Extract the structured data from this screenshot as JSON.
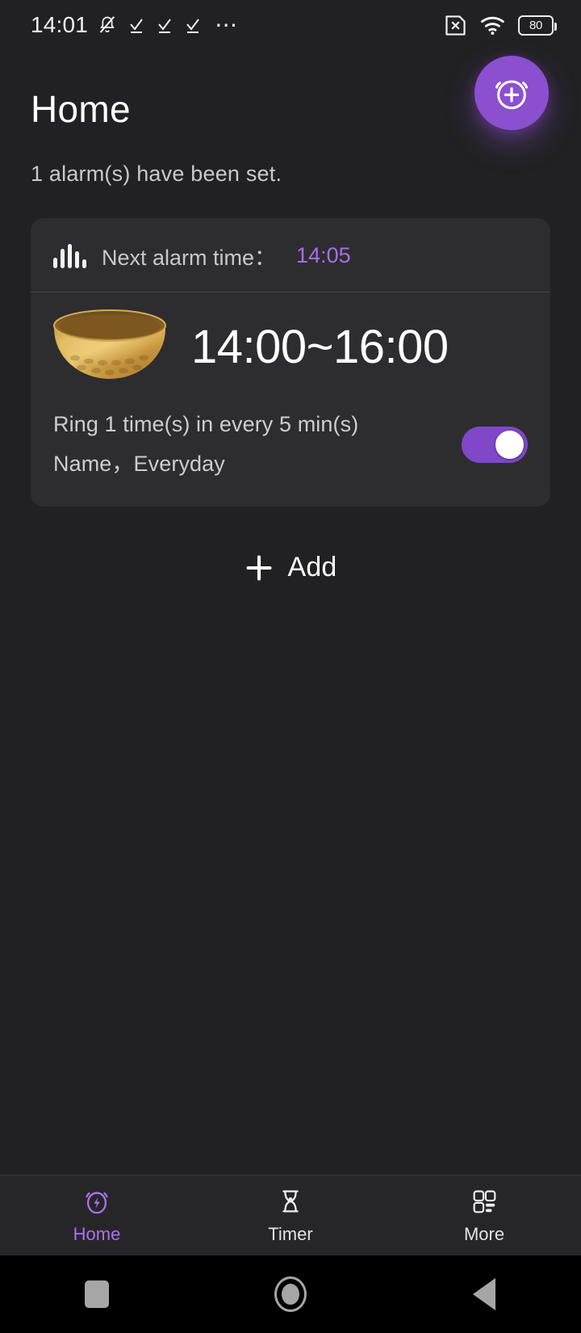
{
  "status_bar": {
    "clock": "14:01",
    "battery_level": "80",
    "icons": [
      "bell-muted-icon",
      "check-icon",
      "check-icon",
      "check-icon",
      "overflow-dots-icon",
      "sim-missing-icon",
      "wifi-icon",
      "battery-icon"
    ]
  },
  "header": {
    "title": "Home",
    "fab_icon": "alarm-add-icon",
    "subtitle": "1 alarm(s) have been set."
  },
  "alarm_card": {
    "wave_icon": "sound-wave-icon",
    "next_alarm_label": "Next alarm time：",
    "next_alarm_time": "14:05",
    "bowl_icon": "singing-bowl-image",
    "time_range": "14:00~16:00",
    "ring_line": "Ring 1 time(s) in every 5 min(s)",
    "name_line": "Name，Everyday",
    "toggle_state": "on"
  },
  "add_button": {
    "icon": "plus-icon",
    "label": "Add"
  },
  "bottom_nav": {
    "items": [
      {
        "label": "Home",
        "icon": "alarm-bolt-icon",
        "active": true
      },
      {
        "label": "Timer",
        "icon": "hourglass-icon",
        "active": false
      },
      {
        "label": "More",
        "icon": "grid-apps-icon",
        "active": false
      }
    ]
  },
  "system_nav": {
    "recents": "recents-square-icon",
    "home": "home-circle-icon",
    "back": "back-triangle-icon"
  },
  "colors": {
    "accent_purple": "#8b4fd0",
    "accent_light": "#a86ded",
    "page_bg": "#212123",
    "card_bg": "#2d2d2f",
    "nav_bg": "#262628",
    "toggle_on": "#8047c8"
  }
}
